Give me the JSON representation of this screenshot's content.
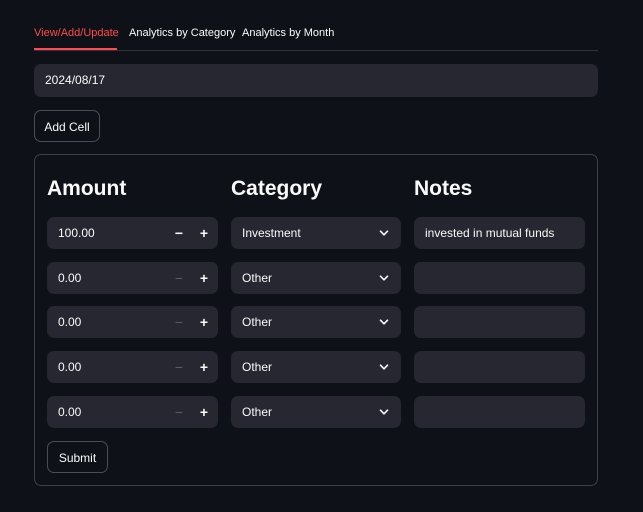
{
  "tabs": [
    {
      "label": "View/Add/Update",
      "active": true
    },
    {
      "label": "Analytics by Category",
      "active": false
    },
    {
      "label": "Analytics by Month",
      "active": false
    }
  ],
  "date_input": {
    "value": "2024/08/17"
  },
  "add_cell_label": "Add Cell",
  "form": {
    "headers": {
      "amount": "Amount",
      "category": "Category",
      "notes": "Notes"
    },
    "rows": [
      {
        "amount": "100.00",
        "category": "Investment",
        "notes": "invested in mutual funds",
        "minus_enabled": true
      },
      {
        "amount": "0.00",
        "category": "Other",
        "notes": "",
        "minus_enabled": false
      },
      {
        "amount": "0.00",
        "category": "Other",
        "notes": "",
        "minus_enabled": false
      },
      {
        "amount": "0.00",
        "category": "Other",
        "notes": "",
        "minus_enabled": false
      },
      {
        "amount": "0.00",
        "category": "Other",
        "notes": "",
        "minus_enabled": false
      }
    ],
    "stepper": {
      "minus": "−",
      "plus": "+"
    },
    "submit_label": "Submit"
  },
  "colors": {
    "background": "#0e1117",
    "input_bg": "#262730",
    "accent": "#ff4b4b",
    "text": "#fafafa",
    "disabled": "#5b5d68"
  },
  "icons": {
    "dropdown": "chevron-down-icon"
  }
}
